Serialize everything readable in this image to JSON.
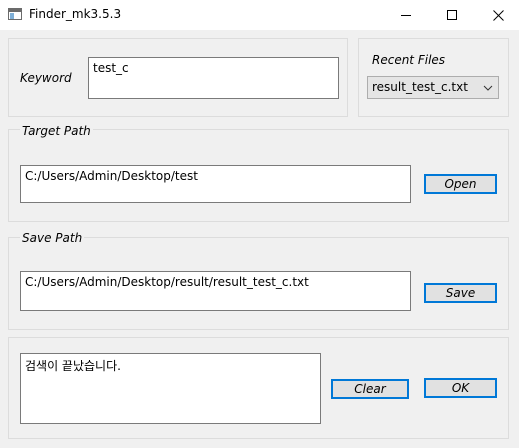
{
  "window": {
    "title": "Finder_mk3.5.3",
    "icon": "app-window-icon"
  },
  "keyword": {
    "label": "Keyword",
    "value": "test_c"
  },
  "recent_files": {
    "label": "Recent Files",
    "selected": "result_test_c.txt"
  },
  "target_path": {
    "label": "Target Path",
    "value": "C:/Users/Admin/Desktop/test",
    "button_label": "Open"
  },
  "save_path": {
    "label": "Save Path",
    "value": "C:/Users/Admin/Desktop/result/result_test_c.txt",
    "button_label": "Save"
  },
  "status": {
    "message": "검색이 끝났습니다.",
    "clear_label": "Clear",
    "ok_label": "OK"
  },
  "colors": {
    "accent_border": "#0078d7",
    "background": "#f0f0f0"
  }
}
